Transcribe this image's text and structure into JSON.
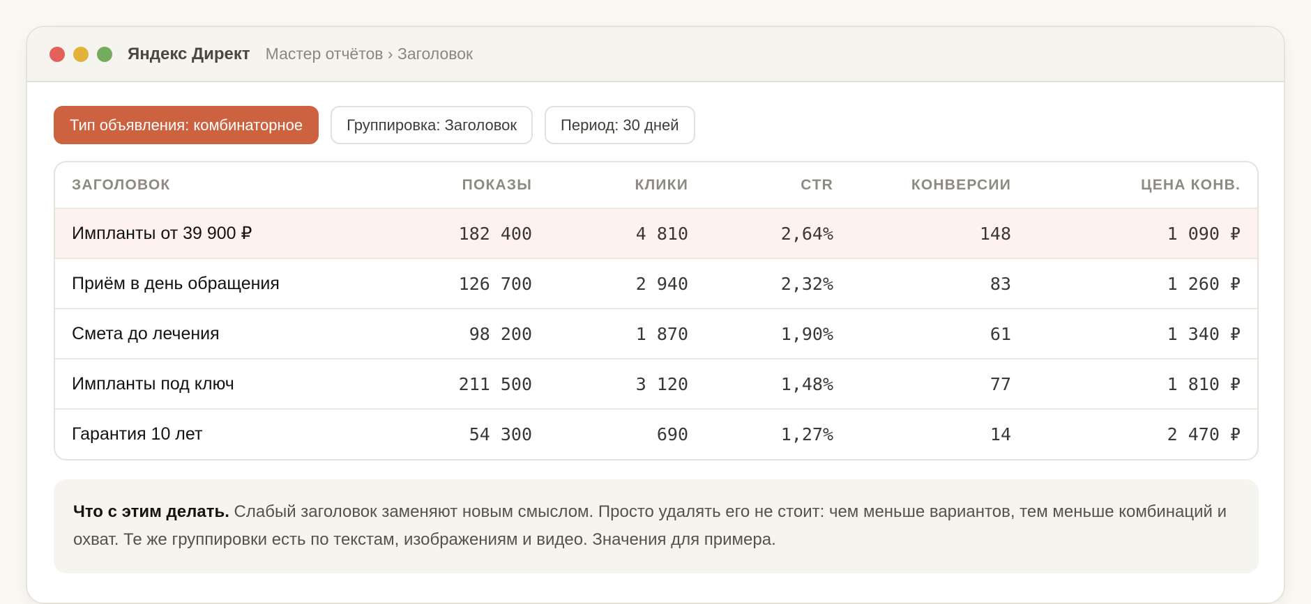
{
  "window": {
    "app_title": "Яндекс Директ",
    "breadcrumb": "Мастер отчётов › Заголовок"
  },
  "filters": [
    {
      "label": "Тип объявления: комбинаторное",
      "active": true
    },
    {
      "label": "Группировка: Заголовок",
      "active": false
    },
    {
      "label": "Период: 30 дней",
      "active": false
    }
  ],
  "table": {
    "columns": [
      "ЗАГОЛОВОК",
      "ПОКАЗЫ",
      "КЛИКИ",
      "CTR",
      "КОНВЕРСИИ",
      "ЦЕНА КОНВ."
    ],
    "rows": [
      {
        "title": "Импланты от 39 900 ₽",
        "impressions": "182 400",
        "clicks": "4 810",
        "ctr": "2,64%",
        "conversions": "148",
        "cpa": "1 090 ₽",
        "highlight": true
      },
      {
        "title": "Приём в день обращения",
        "impressions": "126 700",
        "clicks": "2 940",
        "ctr": "2,32%",
        "conversions": "83",
        "cpa": "1 260 ₽",
        "highlight": false
      },
      {
        "title": "Смета до лечения",
        "impressions": "98 200",
        "clicks": "1 870",
        "ctr": "1,90%",
        "conversions": "61",
        "cpa": "1 340 ₽",
        "highlight": false
      },
      {
        "title": "Импланты под ключ",
        "impressions": "211 500",
        "clicks": "3 120",
        "ctr": "1,48%",
        "conversions": "77",
        "cpa": "1 810 ₽",
        "highlight": false
      },
      {
        "title": "Гарантия 10 лет",
        "impressions": "54 300",
        "clicks": "690",
        "ctr": "1,27%",
        "conversions": "14",
        "cpa": "2 470 ₽",
        "highlight": false
      }
    ]
  },
  "note": {
    "bold": "Что с этим делать.",
    "text": " Слабый заголовок заменяют новым смыслом. Просто удалять его не стоит: чем меньше вариантов, тем меньше комбинаций и охват. Те же группировки есть по текстам, изображениям и видео. Значения для примера."
  },
  "colors": {
    "accent": "#cc6240",
    "highlight_row": "#fdf2ef",
    "window_close": "#e5605a",
    "window_minimize": "#e2b23b",
    "window_maximize": "#74ab5f"
  }
}
